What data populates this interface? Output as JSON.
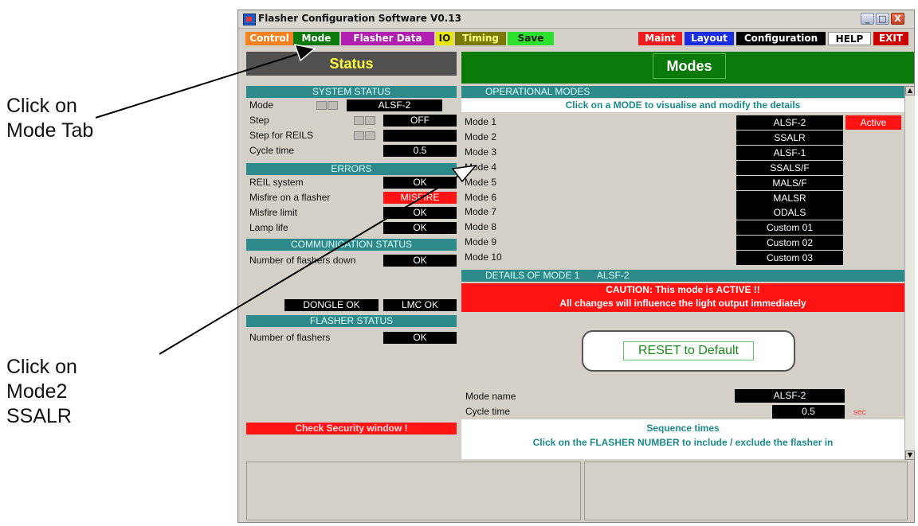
{
  "annotations": {
    "first": [
      "Click on",
      "Mode Tab"
    ],
    "second": [
      "Click on",
      "Mode2",
      "SSALR"
    ]
  },
  "window": {
    "title": "Flasher Configuration Software V0.13",
    "controls": {
      "minimize": "_",
      "maximize": "□",
      "close": "X"
    }
  },
  "tabs": [
    {
      "label": "Control",
      "bg": "#f58220",
      "fg": "#ffffff"
    },
    {
      "label": "Mode",
      "bg": "#0a7a0a",
      "fg": "#ffffff"
    },
    {
      "label": "Flasher Data",
      "bg": "#b01fb0",
      "fg": "#ffffff"
    },
    {
      "label": "IO",
      "bg": "#e8e800",
      "fg": "#1a1a1a"
    },
    {
      "label": "Timing",
      "bg": "#7a7a00",
      "fg": "#ffff80"
    },
    {
      "label": "Save",
      "bg": "#2ee02e",
      "fg": "#1a1a1a"
    },
    {
      "label": "Maint",
      "bg": "#ee1c1c",
      "fg": "#ffffff"
    },
    {
      "label": "Layout",
      "bg": "#1c2ee0",
      "fg": "#ffffff"
    },
    {
      "label": "Configuration",
      "bg": "#000000",
      "fg": "#ffffff"
    },
    {
      "label": "HELP",
      "bg": "#ffffff",
      "fg": "#000000"
    },
    {
      "label": "EXIT",
      "bg": "#cc0000",
      "fg": "#ffffff"
    }
  ],
  "status": {
    "header": "Status",
    "system_status": {
      "title": "SYSTEM STATUS",
      "rows": [
        {
          "label": "Mode",
          "value": "ALSF-2"
        },
        {
          "label": "Step",
          "value": "OFF"
        },
        {
          "label": "Step for REILS",
          "value": ""
        },
        {
          "label": "Cycle time",
          "value": "0.5"
        }
      ]
    },
    "errors": {
      "title": "ERRORS",
      "rows": [
        {
          "label": "REIL system",
          "value": "OK"
        },
        {
          "label": "Misfire on a flasher",
          "value": "MISFIRE"
        },
        {
          "label": "Misfire limit",
          "value": "OK"
        },
        {
          "label": "Lamp life",
          "value": "OK"
        }
      ]
    },
    "communication": {
      "title": "COMMUNICATION STATUS",
      "row": {
        "label": "Number of flashers down",
        "value": "OK"
      }
    },
    "dongle": "DONGLE OK",
    "lmc": "LMC OK",
    "flasher_status": {
      "title": "FLASHER STATUS",
      "row": {
        "label": "Number of flashers",
        "value": "OK"
      }
    },
    "security_warning": "Check Security window !"
  },
  "modes": {
    "header": "Modes",
    "operational_title": "OPERATIONAL MODES",
    "instruction": "Click on a MODE to visualise and modify the details",
    "list": [
      {
        "label": "Mode 1",
        "name": "ALSF-2",
        "state": "Active"
      },
      {
        "label": "Mode 2",
        "name": "SSALR"
      },
      {
        "label": "Mode 3",
        "name": "ALSF-1"
      },
      {
        "label": "Mode 4",
        "name": "SSALS/F"
      },
      {
        "label": "Mode 5",
        "name": "MALS/F"
      },
      {
        "label": "Mode 6",
        "name": "MALSR"
      },
      {
        "label": "Mode 7",
        "name": "ODALS"
      },
      {
        "label": "Mode 8",
        "name": "Custom 01"
      },
      {
        "label": "Mode 9",
        "name": "Custom 02"
      },
      {
        "label": "Mode 10",
        "name": "Custom 03"
      }
    ],
    "details": {
      "title": "DETAILS OF MODE 1",
      "mode": "ALSF-2",
      "caution": "CAUTION: This mode is ACTIVE !!",
      "caution2": "All changes will influence the light output immediately",
      "reset_button": "RESET to Default",
      "mode_name_label": "Mode name",
      "mode_name_value": "ALSF-2",
      "cycle_time_label": "Cycle time",
      "cycle_time_value": "0.5",
      "cycle_time_unit": "sec",
      "sequence_title": "Sequence times",
      "sequence_text": "Click on the FLASHER NUMBER to include / exclude the flasher in"
    }
  }
}
